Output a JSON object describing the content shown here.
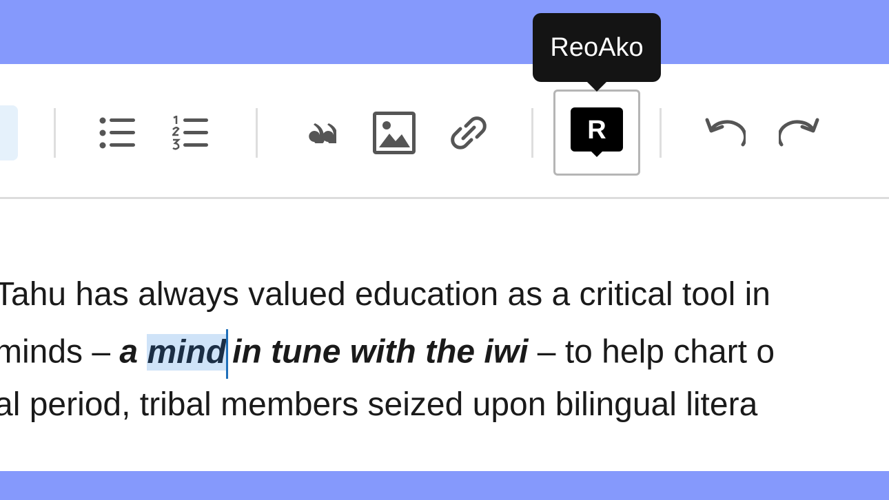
{
  "toolbar": {
    "buttons": [
      {
        "name": "bulleted-list",
        "icon": "bulleted-list-icon"
      },
      {
        "name": "numbered-list",
        "icon": "numbered-list-icon"
      },
      {
        "name": "blockquote",
        "icon": "quote-icon"
      },
      {
        "name": "insert-image",
        "icon": "image-icon"
      },
      {
        "name": "insert-link",
        "icon": "link-icon"
      },
      {
        "name": "reoako",
        "icon": "reoako-r-icon",
        "icon_letter": "R"
      },
      {
        "name": "undo",
        "icon": "undo-icon"
      },
      {
        "name": "redo",
        "icon": "redo-icon"
      }
    ],
    "tooltip": "ReoAko"
  },
  "editor": {
    "line1": "Tahu has always valued education as a critical tool in",
    "line2_before": "minds –",
    "line2_emph_a": "a",
    "line2_selected": "mind",
    "line2_emph_after": "in tune with the iwi",
    "line2_after": "– to help chart o",
    "line3": "al period, tribal members seized upon bilingual litera"
  },
  "colors": {
    "background": "#8599fc",
    "selection": "#cfe3f8",
    "caret": "#1f6fb9",
    "tooltip_bg": "#141414"
  }
}
